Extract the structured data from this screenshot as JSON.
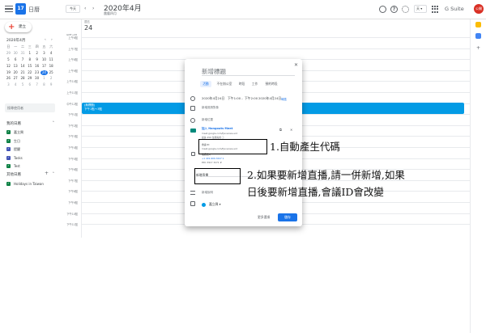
{
  "header": {
    "app_name": "日曆",
    "logo_day": "17",
    "today_label": "今天",
    "month_title": "2020年4月",
    "month_subtitle": "農曆四月",
    "view_label": "天 ▾",
    "brand": "G Suite",
    "avatar_text": "公開"
  },
  "sidebar": {
    "create_label": "建立",
    "mini_month": "2020年4月",
    "weekday_headers": [
      "日",
      "一",
      "二",
      "三",
      "四",
      "五",
      "六"
    ],
    "days": [
      {
        "d": "29",
        "other": true
      },
      {
        "d": "30",
        "other": true
      },
      {
        "d": "31",
        "other": true
      },
      {
        "d": "1"
      },
      {
        "d": "2"
      },
      {
        "d": "3"
      },
      {
        "d": "4"
      },
      {
        "d": "5"
      },
      {
        "d": "6"
      },
      {
        "d": "7"
      },
      {
        "d": "8"
      },
      {
        "d": "9"
      },
      {
        "d": "10"
      },
      {
        "d": "11"
      },
      {
        "d": "12"
      },
      {
        "d": "13"
      },
      {
        "d": "14"
      },
      {
        "d": "15"
      },
      {
        "d": "16"
      },
      {
        "d": "17"
      },
      {
        "d": "18"
      },
      {
        "d": "19"
      },
      {
        "d": "20"
      },
      {
        "d": "21"
      },
      {
        "d": "22"
      },
      {
        "d": "23"
      },
      {
        "d": "24",
        "today": true
      },
      {
        "d": "25"
      },
      {
        "d": "26"
      },
      {
        "d": "27"
      },
      {
        "d": "28"
      },
      {
        "d": "29"
      },
      {
        "d": "30"
      },
      {
        "d": "1",
        "other": true
      },
      {
        "d": "2",
        "other": true
      },
      {
        "d": "3",
        "other": true
      },
      {
        "d": "4",
        "other": true
      },
      {
        "d": "5",
        "other": true
      },
      {
        "d": "6",
        "other": true
      },
      {
        "d": "7",
        "other": true
      },
      {
        "d": "8",
        "other": true
      },
      {
        "d": "9",
        "other": true
      }
    ],
    "people_search_placeholder": "搜尋使用者",
    "my_calendars_title": "我的日曆",
    "my_calendars": [
      {
        "label": "嘉立興",
        "color": "#0b8043"
      },
      {
        "label": "生日",
        "color": "#0b8043"
      },
      {
        "label": "提醒",
        "color": "#3f51b5"
      },
      {
        "label": "Tasks",
        "color": "#3f51b5"
      },
      {
        "label": "Test",
        "color": "#0b8043"
      }
    ],
    "other_calendars_title": "其他日曆",
    "other_calendars": [
      {
        "label": "Holidays in Taiwan",
        "color": "#0b8043"
      }
    ]
  },
  "main": {
    "day_name": "週五",
    "day_number": "24",
    "gmt_label": "GMT+08",
    "time_labels": [
      "上午6點",
      "上午7點",
      "上午8點",
      "上午9點",
      "上午10點",
      "上午11點",
      "中午12點",
      "下午1點",
      "下午2點",
      "下午3點",
      "下午4點",
      "下午5點",
      "下午6點",
      "下午7點",
      "下午8點",
      "下午9點",
      "下午10點",
      "下午11點"
    ],
    "event_title": "(無標題)",
    "event_time": "下午1點～3點"
  },
  "dialog": {
    "title_placeholder": "新增標題",
    "tabs": [
      "活動",
      "不在辦公室",
      "時段",
      "工作",
      "預約時段"
    ],
    "date_text": "2020年4月24日",
    "time_start": "下午1:00",
    "time_end": "下午2:00",
    "end_date_text": "2020年4月24日",
    "tz_label": "時區",
    "add_guests": "新增邀請對象",
    "location_placeholder": "新增位置",
    "meet_join": "加入 Hangouts Meet",
    "meet_link": "meet.google.com/fjw-wcwe-scd",
    "meet_sub": "最多 250 位參與者 ⓘ",
    "meeting_id_label": "會議 ID",
    "meeting_id_value": "meet.google.com/fjw-wcwe-scd",
    "phone_label": "電話加入",
    "phone_value": "+1 401-900-3247 ▾",
    "pin_value": "PIN: 3917 3271 #",
    "live_stream": "新增直播",
    "description_placeholder": "新增說明",
    "calendar_owner": "嘉立興 ▾",
    "more_options": "更多選項",
    "save": "儲存"
  },
  "annotations": {
    "note1": "1.自動產生代碼",
    "note2_line1": "2.如果要新增直播,請一併新增,如果",
    "note2_line2": "日後要新增直播,會議ID會改變"
  },
  "colors": {
    "accent": "#1a73e8",
    "event": "#039be5",
    "brand_red": "#ea4335"
  }
}
